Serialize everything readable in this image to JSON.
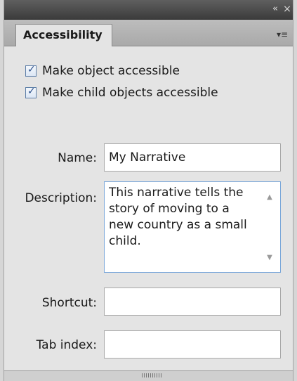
{
  "window": {
    "collapse_icon": "double-chevron-left-icon",
    "close_icon": "close-icon",
    "collapse_glyph": "«",
    "close_glyph": "×"
  },
  "tab": {
    "label": "Accessibility",
    "menu_glyph": "▾≡"
  },
  "options": {
    "make_object_accessible": {
      "label": "Make object accessible",
      "checked": true
    },
    "make_child_objects_accessible": {
      "label": "Make child objects accessible",
      "checked": true
    },
    "check_glyph": "✓"
  },
  "fields": {
    "name": {
      "label": "Name:",
      "value": "My Narrative"
    },
    "description": {
      "label": "Description:",
      "value": "This narrative tells the story of moving to a new country as a small child."
    },
    "shortcut": {
      "label": "Shortcut:",
      "value": ""
    },
    "tab_index": {
      "label": "Tab index:",
      "value": ""
    }
  },
  "scroll": {
    "up_glyph": "▲",
    "down_glyph": "▼"
  },
  "colors": {
    "titlebar": "#4a4a4a",
    "panel_bg": "#e4e4e4",
    "focus_border": "#7aa7d9",
    "checkbox_accent": "#2b4f8a"
  }
}
